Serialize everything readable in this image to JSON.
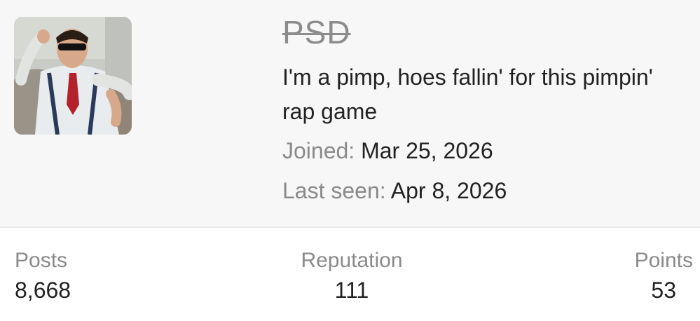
{
  "profile": {
    "username": "PSD",
    "title": "I'm a pimp, hoes fallin' for this pimpin' rap game",
    "joined_label": "Joined:",
    "joined_value": "Mar 25, 2026",
    "last_seen_label": "Last seen:",
    "last_seen_value": "Apr 8, 2026",
    "avatar_icon": "user-avatar-photo"
  },
  "stats": {
    "posts_label": "Posts",
    "posts_value": "8,668",
    "reputation_label": "Reputation",
    "reputation_value": "111",
    "points_label": "Points",
    "points_value": "53"
  },
  "colors": {
    "header_bg": "#f7f7f7",
    "muted_text": "#8a8a8a",
    "primary_text": "#222222"
  }
}
